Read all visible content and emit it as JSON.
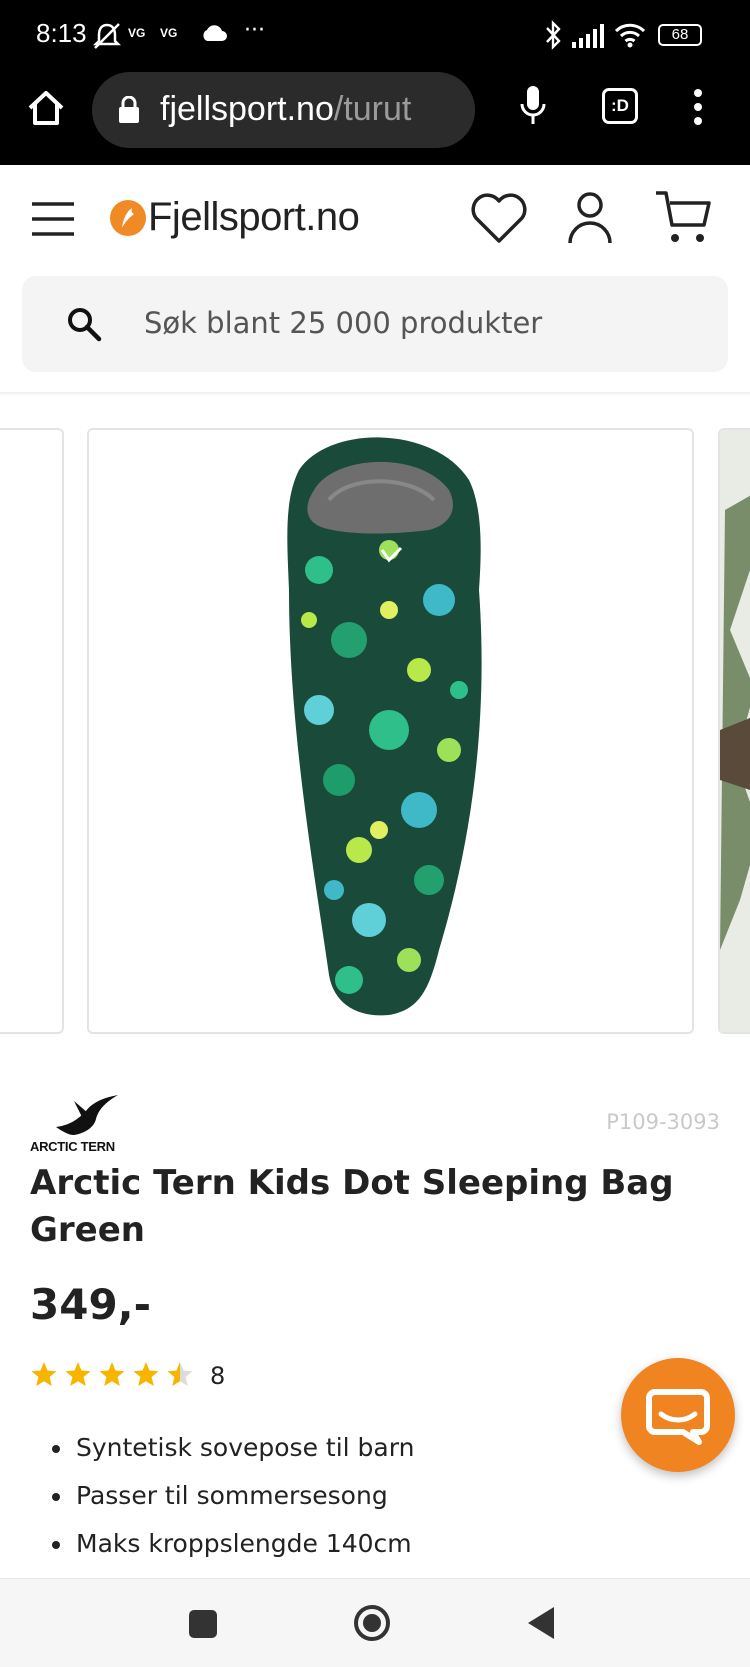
{
  "status_bar": {
    "time": "8:13",
    "carrier1": "VG",
    "carrier2": "VG",
    "more": "···",
    "battery": "68",
    "icons": [
      "mute-notification-icon",
      "cloud-icon",
      "bluetooth-icon",
      "signal-icon",
      "wifi-icon",
      "battery-icon"
    ]
  },
  "browser": {
    "url_domain": "fjellsport.no",
    "url_path": "/turut",
    "icons": [
      "home-icon",
      "lock-icon",
      "mic-icon",
      "tabs-icon",
      "overflow-menu-icon"
    ],
    "tabs_label": ":D"
  },
  "header": {
    "site_name": "Fjellsport.no",
    "icons": [
      "menu-icon",
      "heart-icon",
      "account-icon",
      "cart-icon"
    ],
    "brand_color": "#f08a24"
  },
  "search": {
    "placeholder": "Søk blant 25 000 produkter"
  },
  "product": {
    "brand": "ARCTIC TERN",
    "sku": "P109-3093",
    "title": "Arctic Tern Kids Dot Sleeping Bag Green",
    "price": "349,-",
    "rating": {
      "stars": 4.5,
      "max": 5,
      "count": "8",
      "star_color": "#f7b500"
    },
    "features": [
      "Syntetisk sovepose til barn",
      "Passer til sommersesong",
      "Maks kroppslengde 140cm"
    ]
  },
  "chat": {
    "color": "#ef8421",
    "icon": "chat-icon"
  },
  "system_nav": {
    "icons": [
      "recents-icon",
      "home-circle-icon",
      "back-icon"
    ]
  }
}
